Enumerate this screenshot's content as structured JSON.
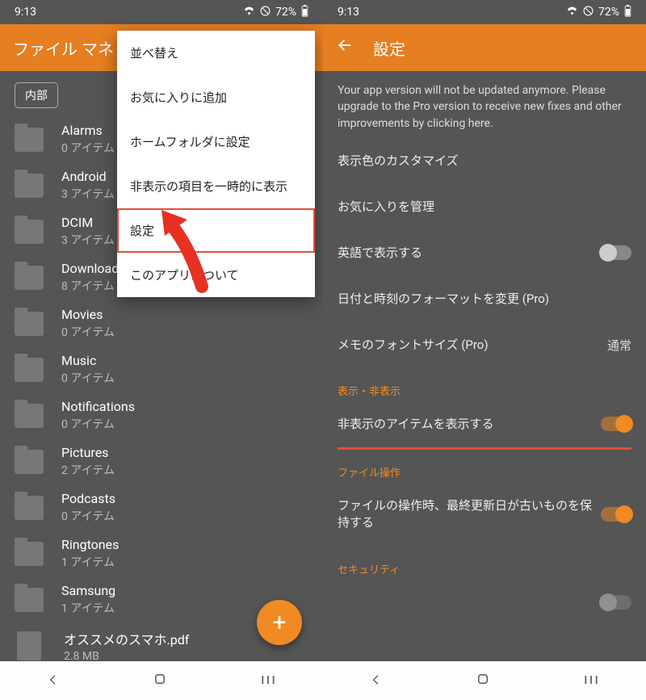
{
  "status": {
    "time": "9:13",
    "battery": "72%"
  },
  "left": {
    "title": "ファイル マネ",
    "chip": "内部",
    "menu": {
      "sort": "並べ替え",
      "favorite": "お気に入りに追加",
      "set_home": "ホームフォルダに設定",
      "show_hidden": "非表示の項目を一時的に表示",
      "settings": "設定",
      "about": "このアプリについて"
    },
    "files": [
      {
        "name": "Alarms",
        "sub": "0 アイテム"
      },
      {
        "name": "Android",
        "sub": "3 アイテム"
      },
      {
        "name": "DCIM",
        "sub": "3 アイテム"
      },
      {
        "name": "Download",
        "sub": "8 アイテム"
      },
      {
        "name": "Movies",
        "sub": "0 アイテム"
      },
      {
        "name": "Music",
        "sub": "0 アイテム"
      },
      {
        "name": "Notifications",
        "sub": "0 アイテム"
      },
      {
        "name": "Pictures",
        "sub": "2 アイテム"
      },
      {
        "name": "Podcasts",
        "sub": "0 アイテム"
      },
      {
        "name": "Ringtones",
        "sub": "1 アイテム"
      },
      {
        "name": "Samsung",
        "sub": "1 アイテム"
      },
      {
        "name": "オススメのスマホ.pdf",
        "sub": "2.8 MB",
        "doc": true
      }
    ],
    "fab": "+"
  },
  "right": {
    "title": "設定",
    "notice": "Your app version will not be updated anymore. Please upgrade to the Pro version to receive new fixes and other improvements by clicking here.",
    "rows": {
      "customize_colors": "表示色のカスタマイズ",
      "manage_favorites": "お気に入りを管理",
      "english": "英語で表示する",
      "date_format": "日付と時刻のフォーマットを変更 (Pro)",
      "font_size": "メモのフォントサイズ (Pro)",
      "font_size_value": "通常",
      "section_visibility": "表示・非表示",
      "show_hidden_items": "非表示のアイテムを表示する",
      "section_file_ops": "ファイル操作",
      "keep_old_date": "ファイルの操作時、最終更新日が古いものを保持する",
      "section_security": "セキュリティ"
    }
  }
}
